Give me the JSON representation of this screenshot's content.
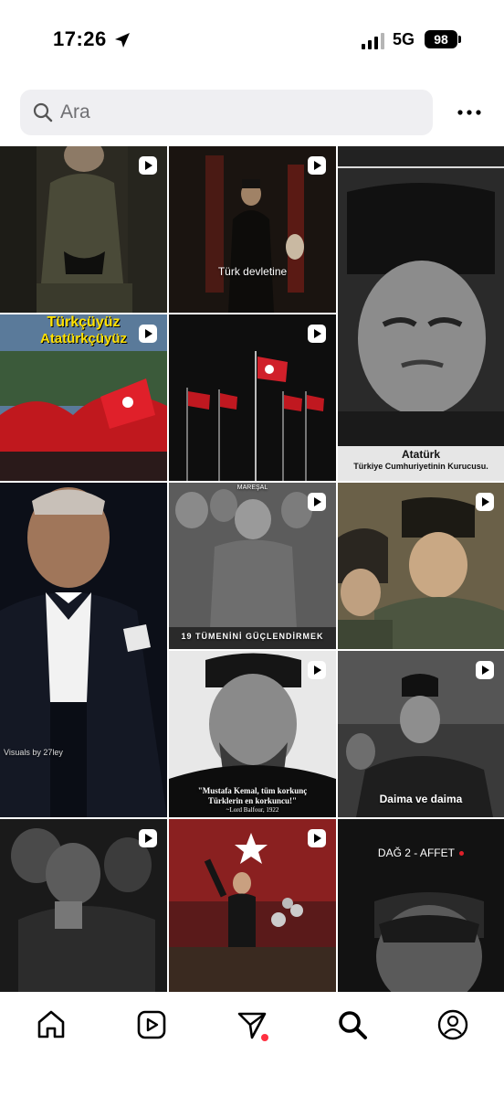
{
  "status_bar": {
    "time": "17:26",
    "network": "5G",
    "battery": "98"
  },
  "search": {
    "placeholder": "Ara"
  },
  "tiles": [
    {
      "id": "r1c1",
      "caption": ""
    },
    {
      "id": "r1c2",
      "caption": "Türk devletine"
    },
    {
      "id": "r1c3",
      "caption_title": "Atatürk",
      "caption_sub": "Türkiye Cumhuriyetinin Kurucusu."
    },
    {
      "id": "r2c1",
      "caption_line1": "Türkçüyüz",
      "caption_line2": "Atatürkçüyüz"
    },
    {
      "id": "r2c2",
      "caption": ""
    },
    {
      "id": "r3c1",
      "caption": "Visuals by 27ley"
    },
    {
      "id": "r3c2",
      "caption_top": "MAREŞAL",
      "caption": "19 TÜMENİNİ GÜÇLENDİRMEK"
    },
    {
      "id": "r3c3",
      "caption": ""
    },
    {
      "id": "r4c2",
      "quote_line1": "\"Mustafa Kemal, tüm korkunç",
      "quote_line2": "Türklerin en korkuncu!\"",
      "quote_author": "~Lord Balfour, 1922"
    },
    {
      "id": "r4c3",
      "caption": "Daima ve daima"
    },
    {
      "id": "r5c1",
      "caption": ""
    },
    {
      "id": "r5c2",
      "caption": ""
    },
    {
      "id": "r5c3",
      "caption": "DAĞ 2 - AFFET"
    }
  ],
  "colors": {
    "accent": "#ff3040",
    "flag_red": "#d0202a",
    "search_bg": "#efeff2"
  },
  "nav": {
    "items": [
      {
        "icon": "home-icon"
      },
      {
        "icon": "reels-icon"
      },
      {
        "icon": "send-icon"
      },
      {
        "icon": "search-icon"
      },
      {
        "icon": "profile-icon"
      }
    ]
  }
}
